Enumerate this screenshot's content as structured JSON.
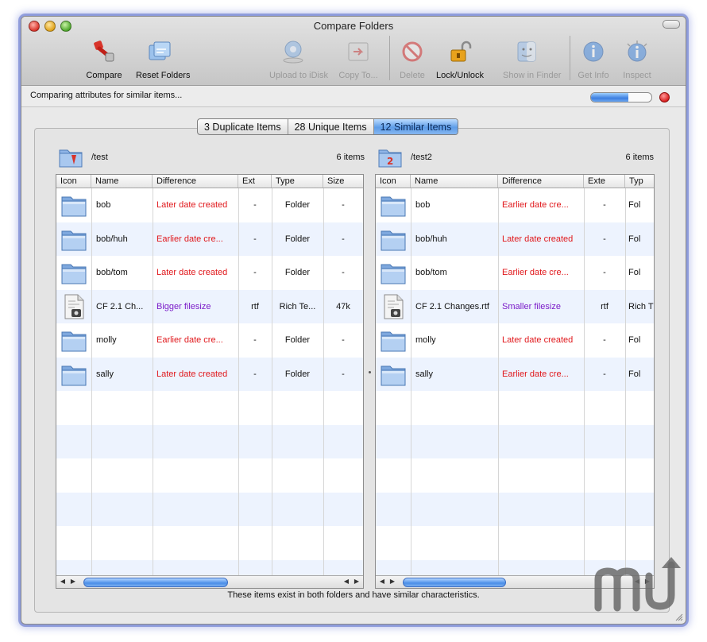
{
  "window": {
    "title": "Compare Folders"
  },
  "toolbar": {
    "buttons": [
      {
        "label": "Compare",
        "icon": "compare-icon",
        "enabled": true
      },
      {
        "label": "Reset Folders",
        "icon": "reset-folders-icon",
        "enabled": true
      },
      {
        "label": "Upload to iDisk",
        "icon": "idisk-icon",
        "enabled": false
      },
      {
        "label": "Copy To...",
        "icon": "copy-to-icon",
        "enabled": false
      },
      {
        "label": "Delete",
        "icon": "delete-icon",
        "enabled": false
      },
      {
        "label": "Lock/Unlock",
        "icon": "lock-icon",
        "enabled": true
      },
      {
        "label": "Show in Finder",
        "icon": "finder-icon",
        "enabled": false
      },
      {
        "label": "Get Info",
        "icon": "info-icon",
        "enabled": false
      },
      {
        "label": "Inspect",
        "icon": "inspect-icon",
        "enabled": false
      }
    ]
  },
  "status": {
    "text": "Comparing attributes for similar items...",
    "progress": 0.62
  },
  "tabs": [
    {
      "label": "3 Duplicate Items",
      "selected": false
    },
    {
      "label": "28 Unique Items",
      "selected": false
    },
    {
      "label": "12 Similar Items",
      "selected": true
    }
  ],
  "left": {
    "path": "/test",
    "count": "6 items",
    "columns": [
      "Icon",
      "Name",
      "Difference",
      "Ext",
      "Type",
      "Size"
    ],
    "rows": [
      {
        "icon": "folder-icon",
        "name": "bob",
        "difference": "Later date created",
        "diff_kind": "date",
        "ext": "-",
        "type": "Folder",
        "size": "-"
      },
      {
        "icon": "folder-icon",
        "name": "bob/huh",
        "difference": "Earlier date cre...",
        "diff_kind": "date",
        "ext": "-",
        "type": "Folder",
        "size": "-"
      },
      {
        "icon": "folder-icon",
        "name": "bob/tom",
        "difference": "Later date created",
        "diff_kind": "date",
        "ext": "-",
        "type": "Folder",
        "size": "-"
      },
      {
        "icon": "rtf-document-icon",
        "name": "CF 2.1 Ch...",
        "difference": "Bigger filesize",
        "diff_kind": "size",
        "ext": "rtf",
        "type": "Rich Te...",
        "size": "47k"
      },
      {
        "icon": "folder-icon",
        "name": "molly",
        "difference": "Earlier date cre...",
        "diff_kind": "date",
        "ext": "-",
        "type": "Folder",
        "size": "-"
      },
      {
        "icon": "folder-icon",
        "name": "sally",
        "difference": "Later date created",
        "diff_kind": "date",
        "ext": "-",
        "type": "Folder",
        "size": "-"
      }
    ]
  },
  "right": {
    "path": "/test2",
    "count": "6 items",
    "columns": [
      "Icon",
      "Name",
      "Difference",
      "Exte",
      "Typ"
    ],
    "rows": [
      {
        "icon": "folder-icon",
        "name": "bob",
        "difference": "Earlier date cre...",
        "diff_kind": "date",
        "ext": "-",
        "type": "Fol"
      },
      {
        "icon": "folder-icon",
        "name": "bob/huh",
        "difference": "Later date created",
        "diff_kind": "date",
        "ext": "-",
        "type": "Fol"
      },
      {
        "icon": "folder-icon",
        "name": "bob/tom",
        "difference": "Earlier date cre...",
        "diff_kind": "date",
        "ext": "-",
        "type": "Fol"
      },
      {
        "icon": "rtf-document-icon",
        "name": "CF 2.1 Changes.rtf",
        "difference": "Smaller filesize",
        "diff_kind": "size",
        "ext": "rtf",
        "type": "Rich T"
      },
      {
        "icon": "folder-icon",
        "name": "molly",
        "difference": "Later date created",
        "diff_kind": "date",
        "ext": "-",
        "type": "Fol"
      },
      {
        "icon": "folder-icon",
        "name": "sally",
        "difference": "Earlier date cre...",
        "diff_kind": "date",
        "ext": "-",
        "type": "Fol"
      }
    ]
  },
  "footer": {
    "message": "These items exist in both folders and have similar characteristics."
  },
  "colors": {
    "date_diff": "#e0171b",
    "size_diff": "#7b1cc8",
    "accent": "#5e9de8",
    "row_alt": "#edf3fe"
  },
  "watermark": {
    "icon": "macupdate-logo-icon"
  }
}
